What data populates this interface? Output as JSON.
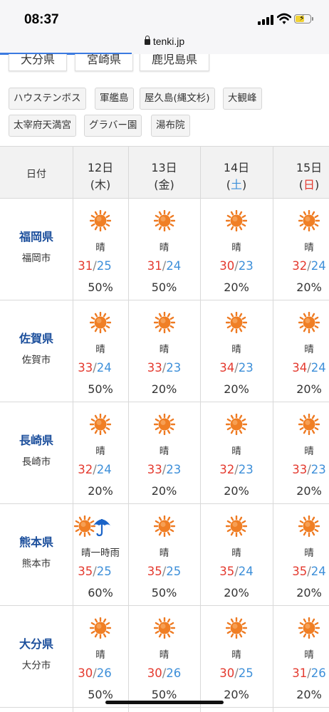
{
  "status": {
    "time": "08:37"
  },
  "browser": {
    "url": "tenki.jp"
  },
  "prefecture_chips": [
    "大分県",
    "宮崎県",
    "鹿児島県"
  ],
  "spot_tags": [
    [
      "ハウステンボス",
      "軍艦島",
      "屋久島(縄文杉)",
      "大観峰"
    ],
    [
      "太宰府天満宮",
      "グラバー園",
      "湯布院"
    ]
  ],
  "table": {
    "header_label": "日付",
    "days": [
      {
        "date": "12日",
        "dow": "(木)",
        "dow_color": "#333333"
      },
      {
        "date": "13日",
        "dow": "(金)",
        "dow_color": "#333333"
      },
      {
        "date": "14日",
        "dow": "(土)",
        "dow_color": "#3d8fd9"
      },
      {
        "date": "15日",
        "dow": "(日)",
        "dow_color": "#e43a2f"
      }
    ],
    "rows": [
      {
        "pref": "福岡県",
        "city": "福岡市",
        "cells": [
          {
            "icon": "sun-icon",
            "weather": "晴",
            "hi": "31",
            "lo": "25",
            "pop": "50%"
          },
          {
            "icon": "sun-icon",
            "weather": "晴",
            "hi": "31",
            "lo": "24",
            "pop": "50%"
          },
          {
            "icon": "sun-icon",
            "weather": "晴",
            "hi": "30",
            "lo": "23",
            "pop": "20%"
          },
          {
            "icon": "sun-icon",
            "weather": "晴",
            "hi": "32",
            "lo": "24",
            "pop": "20%"
          }
        ]
      },
      {
        "pref": "佐賀県",
        "city": "佐賀市",
        "cells": [
          {
            "icon": "sun-icon",
            "weather": "晴",
            "hi": "33",
            "lo": "24",
            "pop": "50%"
          },
          {
            "icon": "sun-icon",
            "weather": "晴",
            "hi": "33",
            "lo": "23",
            "pop": "20%"
          },
          {
            "icon": "sun-icon",
            "weather": "晴",
            "hi": "34",
            "lo": "23",
            "pop": "20%"
          },
          {
            "icon": "sun-icon",
            "weather": "晴",
            "hi": "34",
            "lo": "24",
            "pop": "20%"
          }
        ]
      },
      {
        "pref": "長崎県",
        "city": "長崎市",
        "cells": [
          {
            "icon": "sun-icon",
            "weather": "晴",
            "hi": "32",
            "lo": "24",
            "pop": "20%"
          },
          {
            "icon": "sun-icon",
            "weather": "晴",
            "hi": "33",
            "lo": "23",
            "pop": "20%"
          },
          {
            "icon": "sun-icon",
            "weather": "晴",
            "hi": "32",
            "lo": "23",
            "pop": "20%"
          },
          {
            "icon": "sun-icon",
            "weather": "晴",
            "hi": "33",
            "lo": "23",
            "pop": "20%"
          }
        ]
      },
      {
        "pref": "熊本県",
        "city": "熊本市",
        "cells": [
          {
            "icon": "sun-umbrella-icon",
            "weather": "晴一時雨",
            "hi": "35",
            "lo": "25",
            "pop": "60%"
          },
          {
            "icon": "sun-icon",
            "weather": "晴",
            "hi": "35",
            "lo": "25",
            "pop": "50%"
          },
          {
            "icon": "sun-icon",
            "weather": "晴",
            "hi": "35",
            "lo": "24",
            "pop": "20%"
          },
          {
            "icon": "sun-icon",
            "weather": "晴",
            "hi": "35",
            "lo": "24",
            "pop": "20%"
          }
        ]
      },
      {
        "pref": "大分県",
        "city": "大分市",
        "cells": [
          {
            "icon": "sun-icon",
            "weather": "晴",
            "hi": "30",
            "lo": "26",
            "pop": "50%"
          },
          {
            "icon": "sun-icon",
            "weather": "晴",
            "hi": "30",
            "lo": "26",
            "pop": "50%"
          },
          {
            "icon": "sun-icon",
            "weather": "晴",
            "hi": "30",
            "lo": "25",
            "pop": "20%"
          },
          {
            "icon": "sun-icon",
            "weather": "晴",
            "hi": "31",
            "lo": "26",
            "pop": "20%"
          }
        ]
      }
    ]
  },
  "colors": {
    "hi": "#e43a2f",
    "lo": "#3d8fd9",
    "pref_link": "#1c4f9c",
    "accent": "#3b7ae0"
  }
}
